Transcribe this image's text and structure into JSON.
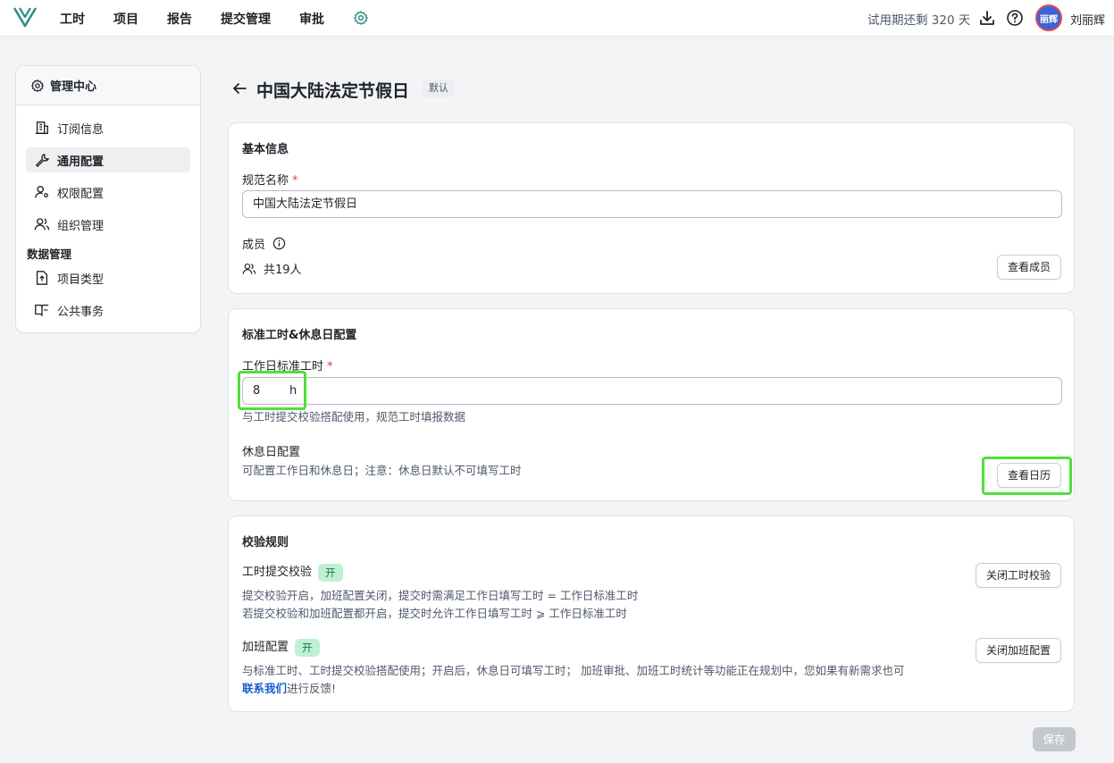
{
  "nav": {
    "items": [
      "工时",
      "项目",
      "报告",
      "提交管理",
      "审批"
    ],
    "trial_text": "试用期还剩 320 天",
    "avatar_text": "丽辉",
    "username": "刘丽辉"
  },
  "sidebar": {
    "header": "管理中心",
    "items": [
      {
        "label": "订阅信息",
        "icon": "building-icon"
      },
      {
        "label": "通用配置",
        "icon": "wrench-icon",
        "active": true
      },
      {
        "label": "权限配置",
        "icon": "user-key-icon"
      },
      {
        "label": "组织管理",
        "icon": "users-icon"
      }
    ],
    "group_label": "数据管理",
    "group_items": [
      {
        "label": "项目类型",
        "icon": "file-icon"
      },
      {
        "label": "公共事务",
        "icon": "book-icon"
      }
    ]
  },
  "page": {
    "title": "中国大陆法定节假日",
    "tag": "默认"
  },
  "basic_info": {
    "title": "基本信息",
    "name_label": "规范名称",
    "required_mark": "*",
    "name_value": "中国大陆法定节假日",
    "members_label": "成员",
    "members_count": "共19人",
    "view_members": "查看成员"
  },
  "standard_hours": {
    "title": "标准工时&休息日配置",
    "workday_label": "工作日标准工时",
    "workday_value": "8",
    "workday_unit": "h",
    "workday_desc": "与工时提交校验搭配使用，规范工时填报数据",
    "rest_label": "休息日配置",
    "rest_desc": "可配置工作日和休息日；注意：休息日默认不可填写工时",
    "view_calendar": "查看日历"
  },
  "rules": {
    "title": "校验规则",
    "submit_check_label": "工时提交校验",
    "submit_check_status": "开",
    "submit_check_desc1": "提交校验开启，加班配置关闭，提交时需满足工作日填写工时 = 工作日标准工时",
    "submit_check_desc2": "若提交校验和加班配置都开启，提交时允许工作日填写工时 ⩾ 工作日标准工时",
    "close_submit_check": "关闭工时校验",
    "overtime_label": "加班配置",
    "overtime_status": "开",
    "overtime_desc": "与标准工时、工时提交校验搭配使用；开启后，休息日可填写工时； 加班审批、加班工时统计等功能正在规划中，您如果有新需求也可",
    "contact_link": "联系我们",
    "feedback_suffix": "进行反馈!",
    "close_overtime": "关闭加班配置"
  },
  "save_label": "保存",
  "colors": {
    "highlight": "#4fe03a",
    "badge_on_bg": "#bff0d6",
    "link": "#1860c9"
  }
}
